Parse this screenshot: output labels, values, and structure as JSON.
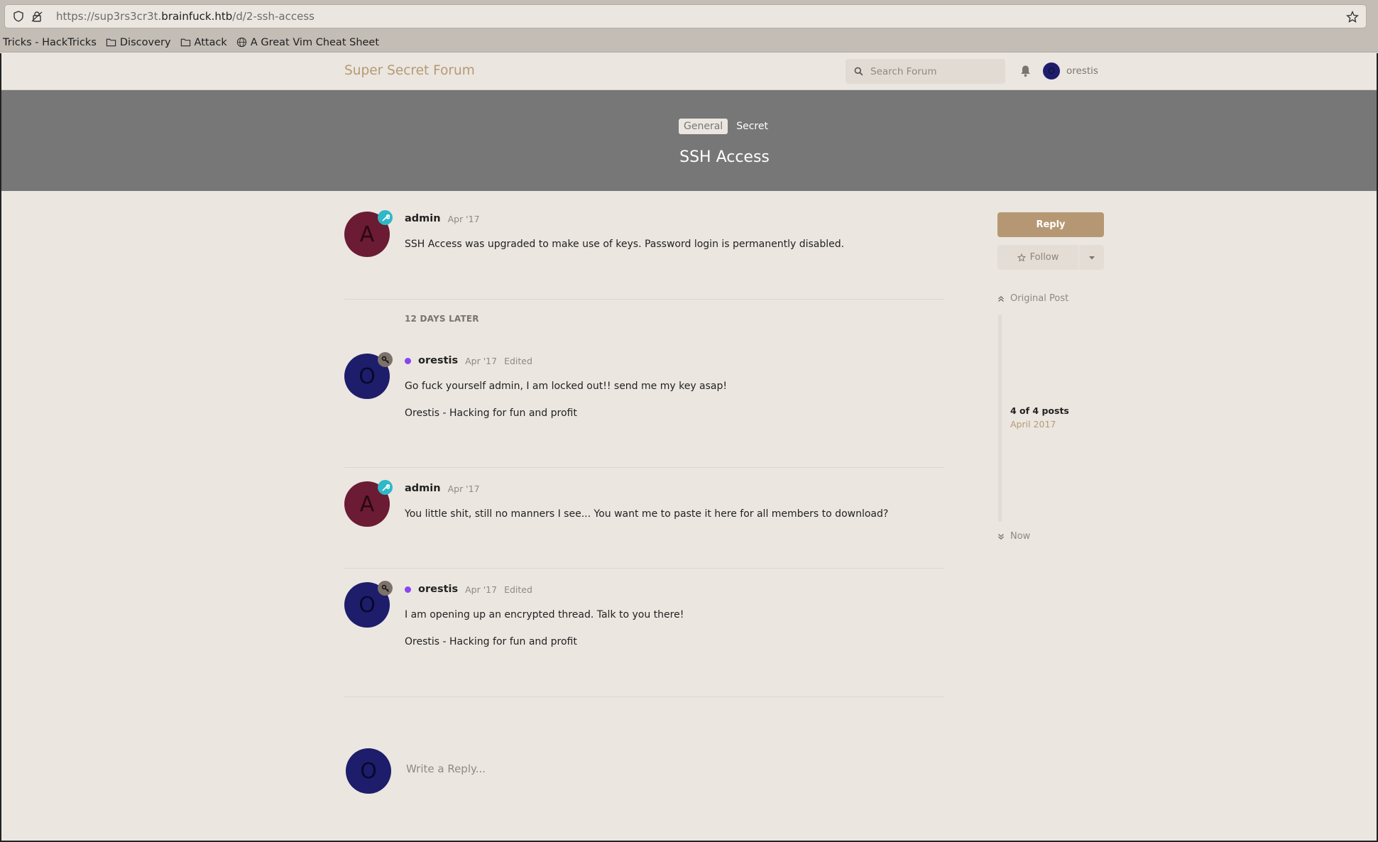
{
  "browser": {
    "url_prefix": "https://sup3rs3cr3t.",
    "url_host": "brainfuck.htb",
    "url_path": "/d/2-ssh-access",
    "bookmarks": [
      {
        "label": "Tricks - HackTricks",
        "icon": "none"
      },
      {
        "label": "Discovery",
        "icon": "folder-icon"
      },
      {
        "label": "Attack",
        "icon": "folder-icon"
      },
      {
        "label": "A Great Vim Cheat Sheet",
        "icon": "globe-icon"
      }
    ]
  },
  "header": {
    "brand": "Super Secret Forum",
    "search_placeholder": "Search Forum",
    "user_initial": "O",
    "username": "orestis"
  },
  "discussion": {
    "tags": [
      "General",
      "Secret"
    ],
    "title": "SSH Access"
  },
  "posts": [
    {
      "author": "admin",
      "initial": "A",
      "date": "Apr '17",
      "edited": "",
      "body": [
        "SSH Access was upgraded to make use of keys. Password login is permanently disabled."
      ]
    },
    {
      "author": "orestis",
      "initial": "O",
      "date": "Apr '17",
      "edited": "Edited",
      "body": [
        "Go fuck yourself admin, I am locked out!! send me my key asap!",
        "Orestis - Hacking for fun and profit"
      ]
    },
    {
      "author": "admin",
      "initial": "A",
      "date": "Apr '17",
      "edited": "",
      "body": [
        "You little shit, still no manners I see... You want me to paste it here for all members to download?"
      ]
    },
    {
      "author": "orestis",
      "initial": "O",
      "date": "Apr '17",
      "edited": "Edited",
      "body": [
        "I am opening up an encrypted thread. Talk to you there!",
        "Orestis - Hacking for fun and profit"
      ]
    }
  ],
  "time_gap": "12 DAYS LATER",
  "composer": {
    "initial": "O",
    "placeholder": "Write a Reply..."
  },
  "sidebar": {
    "reply_label": "Reply",
    "follow_label": "Follow",
    "original_post": "Original Post",
    "count": "4 of 4 posts",
    "date": "April 2017",
    "now": "Now"
  },
  "colors": {
    "accent": "#b59873",
    "hero": "#777777",
    "background": "#ebe6e0",
    "admin_avatar": "#6b1b34",
    "orestis_avatar": "#1d1d6b",
    "online": "#8a44f0",
    "mod_badge": "#2fb8c8"
  }
}
